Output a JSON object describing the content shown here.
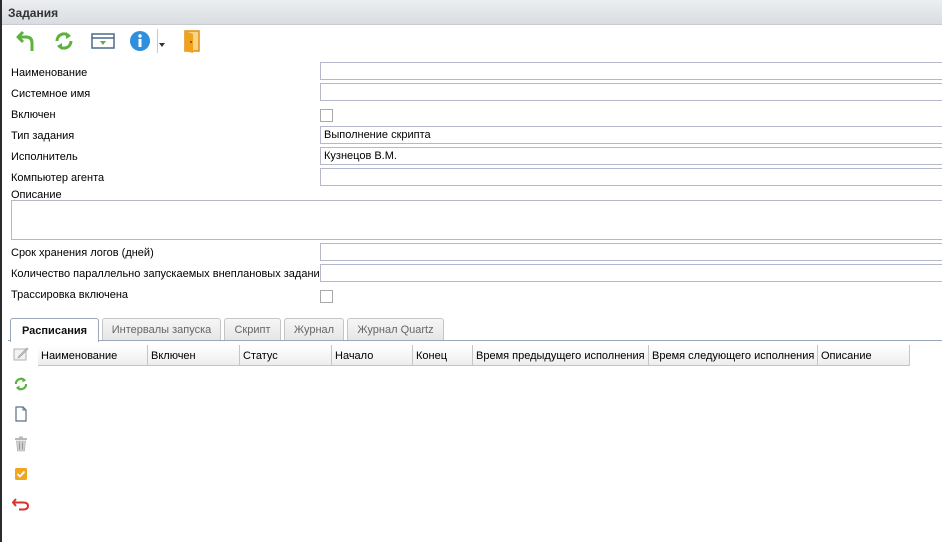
{
  "window": {
    "title": "Задания"
  },
  "toolbar": {
    "buttons": [
      {
        "name": "back-icon"
      },
      {
        "name": "refresh-icon"
      },
      {
        "name": "save-icon"
      },
      {
        "name": "info-icon"
      },
      {
        "name": "exit-door-icon"
      }
    ]
  },
  "form": {
    "name_label": "Наименование",
    "name_value": "",
    "sysname_label": "Системное имя",
    "sysname_value": "",
    "enabled_label": "Включен",
    "task_type_label": "Тип задания",
    "task_type_value": "Выполнение скрипта",
    "executor_label": "Исполнитель",
    "executor_value": "Кузнецов В.М.",
    "agent_label": "Компьютер агента",
    "agent_value": "",
    "description_label": "Описание",
    "description_value": "",
    "log_days_label": "Срок хранения логов (дней)",
    "log_days_value": "",
    "parallel_label": "Количество параллельно запускаемых внеплановых заданий",
    "parallel_value": "",
    "trace_label": "Трассировка включена"
  },
  "tabs": [
    {
      "label": "Расписания",
      "active": true
    },
    {
      "label": "Интервалы запуска"
    },
    {
      "label": "Скрипт"
    },
    {
      "label": "Журнал"
    },
    {
      "label": "Журнал Quartz"
    }
  ],
  "schedule_grid": {
    "columns": [
      "Наименование",
      "Включен",
      "Статус",
      "Начало",
      "Конец",
      "Время предыдущего исполнения",
      "Время следующего исполнения",
      "Описание"
    ],
    "rows": []
  },
  "side_tools": [
    "edit-icon",
    "refresh-icon",
    "new-document-icon",
    "delete-icon",
    "check-icon",
    "undo-icon"
  ],
  "colors": {
    "accent_green": "#5bb33e",
    "info_blue": "#2f8fdd",
    "door_orange": "#f0a21c",
    "undo_red": "#d9342b"
  }
}
